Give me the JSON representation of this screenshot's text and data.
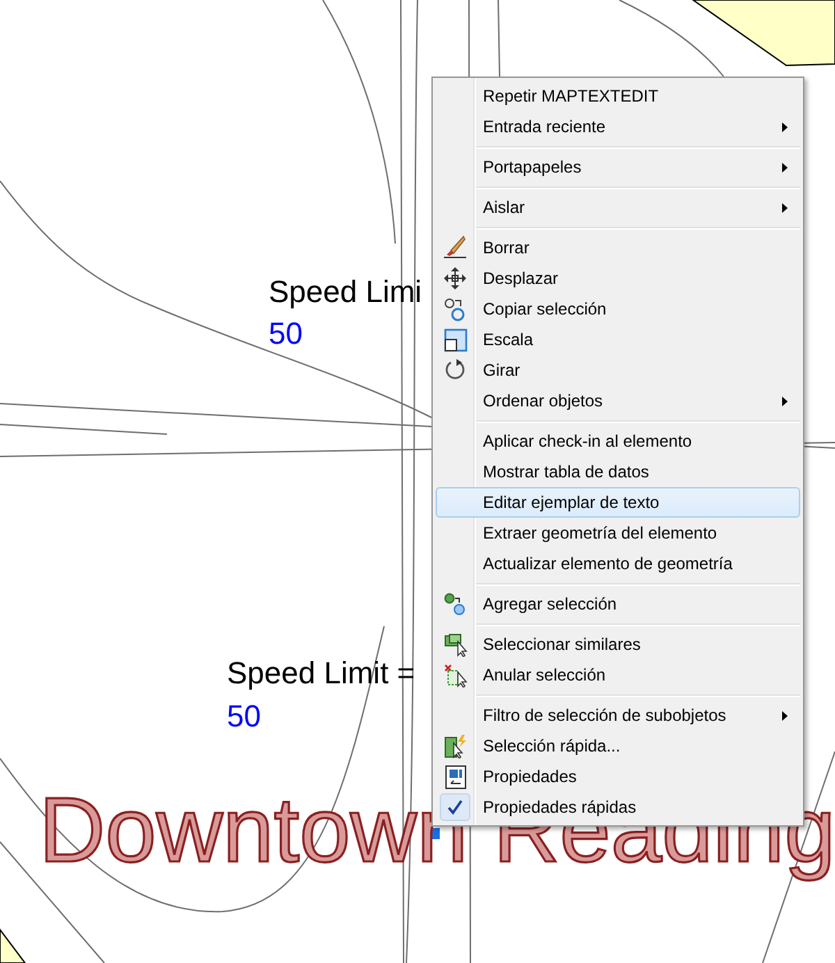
{
  "canvas": {
    "labels": [
      {
        "kind": "speed",
        "text": "Speed Limi"
      },
      {
        "kind": "value",
        "text": "50"
      },
      {
        "kind": "speed",
        "text": "Speed Limit ="
      },
      {
        "kind": "value",
        "text": "50"
      },
      {
        "kind": "area",
        "text": "Downtown Reading"
      }
    ]
  },
  "menu": {
    "groups": [
      [
        {
          "label": "Repetir MAPTEXTEDIT",
          "submenu": false,
          "selected": false,
          "checked": false
        },
        {
          "label": "Entrada reciente",
          "submenu": true,
          "selected": false,
          "checked": false
        }
      ],
      [
        {
          "label": "Portapapeles",
          "submenu": true,
          "selected": false,
          "checked": false
        }
      ],
      [
        {
          "label": "Aislar",
          "submenu": true,
          "selected": false,
          "checked": false
        }
      ],
      [
        {
          "label": "Borrar",
          "submenu": false,
          "selected": false,
          "checked": false
        },
        {
          "label": "Desplazar",
          "submenu": false,
          "selected": false,
          "checked": false
        },
        {
          "label": "Copiar selección",
          "submenu": false,
          "selected": false,
          "checked": false
        },
        {
          "label": "Escala",
          "submenu": false,
          "selected": false,
          "checked": false
        },
        {
          "label": "Girar",
          "submenu": false,
          "selected": false,
          "checked": false
        },
        {
          "label": "Ordenar objetos",
          "submenu": true,
          "selected": false,
          "checked": false
        }
      ],
      [
        {
          "label": "Aplicar check-in al elemento",
          "submenu": false,
          "selected": false,
          "checked": false
        },
        {
          "label": "Mostrar tabla de datos",
          "submenu": false,
          "selected": false,
          "checked": false
        },
        {
          "label": "Editar ejemplar de texto",
          "submenu": false,
          "selected": true,
          "checked": false
        },
        {
          "label": "Extraer geometría del elemento",
          "submenu": false,
          "selected": false,
          "checked": false
        },
        {
          "label": "Actualizar elemento de geometría",
          "submenu": false,
          "selected": false,
          "checked": false
        }
      ],
      [
        {
          "label": "Agregar selección",
          "submenu": false,
          "selected": false,
          "checked": false
        }
      ],
      [
        {
          "label": "Seleccionar similares",
          "submenu": false,
          "selected": false,
          "checked": false
        },
        {
          "label": "Anular selección",
          "submenu": false,
          "selected": false,
          "checked": false
        }
      ],
      [
        {
          "label": "Filtro de selección de subobjetos",
          "submenu": true,
          "selected": false,
          "checked": false
        },
        {
          "label": "Selección rápida...",
          "submenu": false,
          "selected": false,
          "checked": false
        },
        {
          "label": "Propiedades",
          "submenu": false,
          "selected": false,
          "checked": false
        },
        {
          "label": "Propiedades rápidas",
          "submenu": false,
          "selected": false,
          "checked": true
        }
      ]
    ]
  }
}
